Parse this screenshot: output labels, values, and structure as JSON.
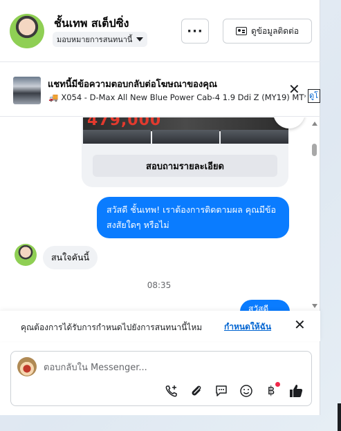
{
  "header": {
    "name": "ชั้นเทพ สเต็ปซิ่ง",
    "assign_label": "มอบหมายการสนทนานี้",
    "more_label": "···",
    "contact_label": "ดูข้อมูลติดต่อ"
  },
  "ad_banner": {
    "title": "แชทนี้มีข้อความตอบกลับต่อโฆษณาของคุณ",
    "subtitle": "X054 - D-Max All New Blue Power Cab-4 1.9 Ddi Z (MY19) MT*...",
    "link_text": "ดูโ",
    "close_label": "✕"
  },
  "chat": {
    "ad_card": {
      "price": "479,000",
      "button_label": "สอบถามรายละเอียด"
    },
    "messages": [
      {
        "direction": "out",
        "text": "สวัสดี ชั้นเทพ! เราต้องการติดตามผล คุณมีข้อสงสัยใดๆ หรือไม่"
      },
      {
        "direction": "in",
        "text": "สนใจคันนี้"
      },
      {
        "direction": "time",
        "text": "08:35"
      },
      {
        "direction": "out",
        "text": "สวัสดี ชั้น"
      }
    ]
  },
  "reminder": {
    "text": "คุณต้องการได้รับการกำหนดไปยังการสนทนานี้ไหม",
    "link": "กำหนดให้ฉัน",
    "close_label": "✕"
  },
  "composer": {
    "placeholder": "ตอบกลับใน Messenger...",
    "tools": [
      "call-plus-icon",
      "paperclip-icon",
      "quick-reply-icon",
      "emoji-icon",
      "baht-icon",
      "thumbs-up-icon"
    ],
    "accent": "#0a7cff"
  }
}
